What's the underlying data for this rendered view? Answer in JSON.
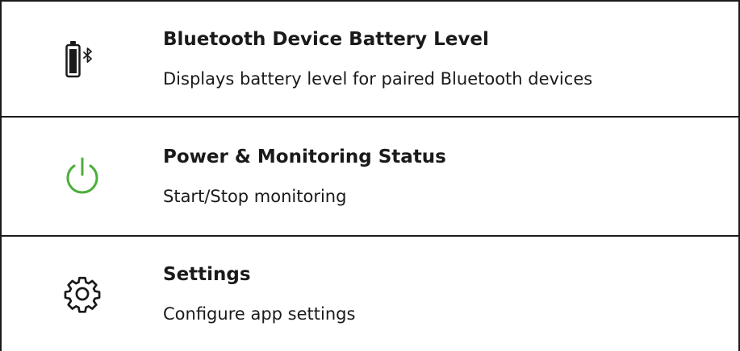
{
  "menu": {
    "items": [
      {
        "title": "Bluetooth Device Battery Level",
        "description": "Displays battery level for paired Bluetooth devices",
        "icon": "battery-bluetooth-icon"
      },
      {
        "title": "Power & Monitoring Status",
        "description": "Start/Stop monitoring",
        "icon": "power-icon"
      },
      {
        "title": "Settings",
        "description": "Configure app settings",
        "icon": "gear-icon"
      }
    ]
  },
  "colors": {
    "text": "#1a1a1a",
    "border": "#1a1a1a",
    "power_green": "#4caf3a"
  }
}
